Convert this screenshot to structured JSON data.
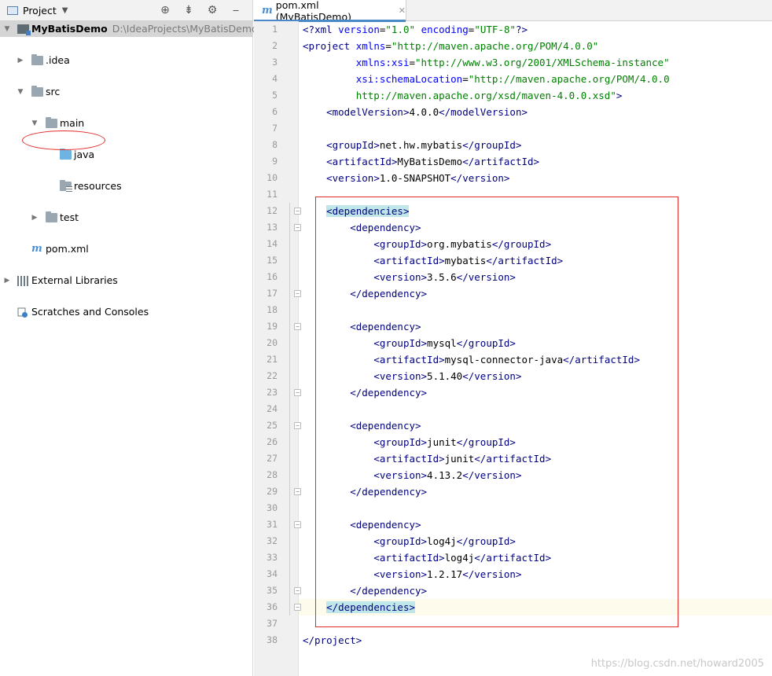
{
  "project_panel": {
    "title": "Project",
    "tree": [
      {
        "name": "MyBatisDemo",
        "path": "D:\\IdeaProjects\\MyBatisDemo"
      },
      {
        "name": ".idea"
      },
      {
        "name": "src"
      },
      {
        "name": "main"
      },
      {
        "name": "java"
      },
      {
        "name": "resources"
      },
      {
        "name": "test"
      },
      {
        "name": "pom.xml"
      },
      {
        "name": "External Libraries"
      },
      {
        "name": "Scratches and Consoles"
      }
    ]
  },
  "editor": {
    "tab_label": "pom.xml (MyBatisDemo)",
    "line_numbers": [
      "1",
      "2",
      "3",
      "4",
      "5",
      "6",
      "7",
      "8",
      "9",
      "10",
      "11",
      "12",
      "13",
      "14",
      "15",
      "16",
      "17",
      "18",
      "19",
      "20",
      "21",
      "22",
      "23",
      "24",
      "25",
      "26",
      "27",
      "28",
      "29",
      "30",
      "31",
      "32",
      "33",
      "34",
      "35",
      "36",
      "37",
      "38"
    ],
    "xml_decl": {
      "version": "\"1.0\"",
      "encoding": "\"UTF-8\""
    },
    "project": {
      "xmlns": "\"http://maven.apache.org/POM/4.0.0\"",
      "xmlns_xsi": "\"http://www.w3.org/2001/XMLSchema-instance\"",
      "schema_location_1": "\"http://maven.apache.org/POM/4.0.0",
      "schema_location_2": "http://maven.apache.org/xsd/maven-4.0.0.xsd\"",
      "model_version": "4.0.0",
      "group_id": "net.hw.mybatis",
      "artifact_id": "MyBatisDemo",
      "version": "1.0-SNAPSHOT"
    },
    "dependencies": [
      {
        "groupId": "org.mybatis",
        "artifactId": "mybatis",
        "version": "3.5.6"
      },
      {
        "groupId": "mysql",
        "artifactId": "mysql-connector-java",
        "version": "5.1.40"
      },
      {
        "groupId": "junit",
        "artifactId": "junit",
        "version": "4.13.2"
      },
      {
        "groupId": "log4j",
        "artifactId": "log4j",
        "version": "1.2.17"
      }
    ]
  },
  "watermark": "https://blog.csdn.net/howard2005"
}
